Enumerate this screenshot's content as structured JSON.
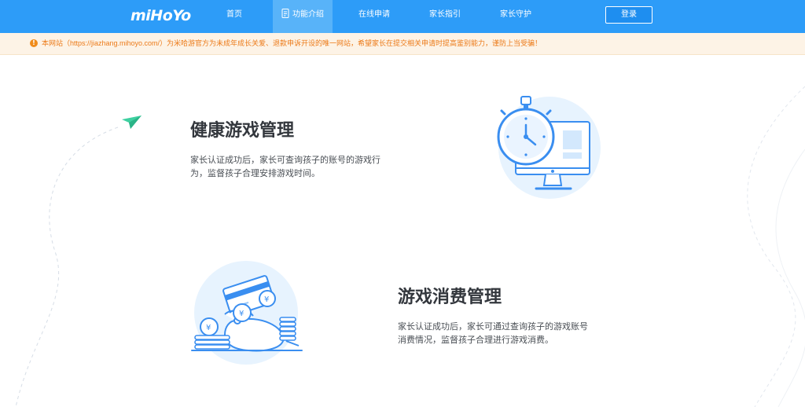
{
  "header": {
    "logo": "miHoYo",
    "nav": [
      {
        "label": "首页",
        "active": false
      },
      {
        "label": "功能介绍",
        "active": true
      },
      {
        "label": "在线申请",
        "active": false
      },
      {
        "label": "家长指引",
        "active": false
      },
      {
        "label": "家长守护",
        "active": false
      }
    ],
    "login_label": "登录"
  },
  "notice": {
    "icon": "info-icon",
    "text": "本网站（https://jiazhang.mihoyo.com/）为米哈游官方为未成年成长关爱、退款申诉开设的唯一网站，希望家长在提交相关申请时提高鉴别能力，谨防上当受骗！"
  },
  "features": [
    {
      "title": "健康游戏管理",
      "desc_lines": [
        "家长认证成功后，家长可查询孩子的账号的游戏行",
        "为，监督孩子合理安排游戏时间。"
      ],
      "illustration": "stopwatch-monitor-icon"
    },
    {
      "title": "游戏消费管理",
      "desc_lines": [
        "家长认证成功后，家长可通过查询孩子的游戏账号",
        "消费情况，监督孩子合理进行游戏消费。"
      ],
      "illustration": "money-bag-coins-icon"
    }
  ],
  "colors": {
    "primary": "#2d9cf8",
    "nav_active": "#58b3f9",
    "notice_bg": "#fdf3e6",
    "notice_text": "#ec7a18",
    "illustration_bg": "#e7f3fe",
    "illustration_stroke": "#3a8ef0",
    "paper_plane": "#3ed0a0"
  }
}
